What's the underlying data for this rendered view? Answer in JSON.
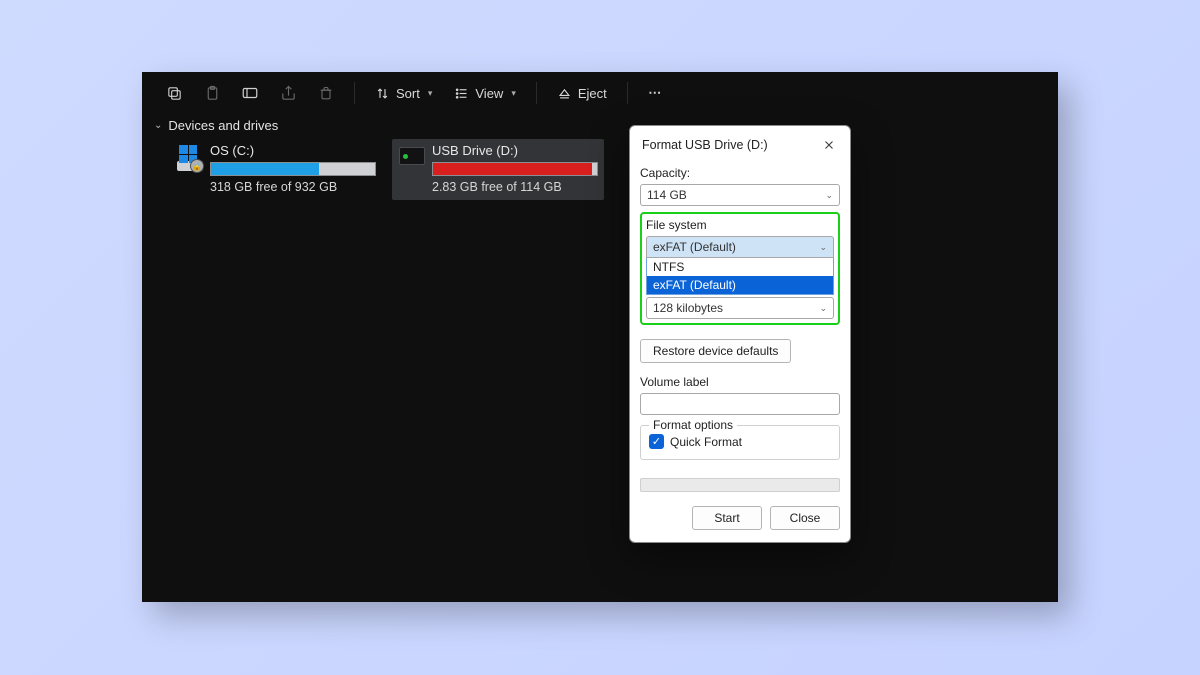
{
  "toolbar": {
    "sort_label": "Sort",
    "view_label": "View",
    "eject_label": "Eject"
  },
  "group_header": "Devices and drives",
  "drives": [
    {
      "name": "OS (C:)",
      "free_text": "318 GB free of 932 GB",
      "fill_color": "#1fa0e6",
      "fill_pct": 66
    },
    {
      "name": "USB Drive (D:)",
      "free_text": "2.83 GB free of 114 GB",
      "fill_color": "#d9201e",
      "fill_pct": 97
    }
  ],
  "dialog": {
    "title": "Format USB Drive (D:)",
    "capacity_label": "Capacity:",
    "capacity_value": "114 GB",
    "filesystem_label": "File system",
    "filesystem_value": "exFAT (Default)",
    "filesystem_options": [
      "NTFS",
      "exFAT (Default)"
    ],
    "alloc_value": "128 kilobytes",
    "restore_label": "Restore device defaults",
    "volume_label": "Volume label",
    "volume_value": "",
    "format_options_label": "Format options",
    "quick_format_label": "Quick Format",
    "start_label": "Start",
    "close_label": "Close"
  }
}
